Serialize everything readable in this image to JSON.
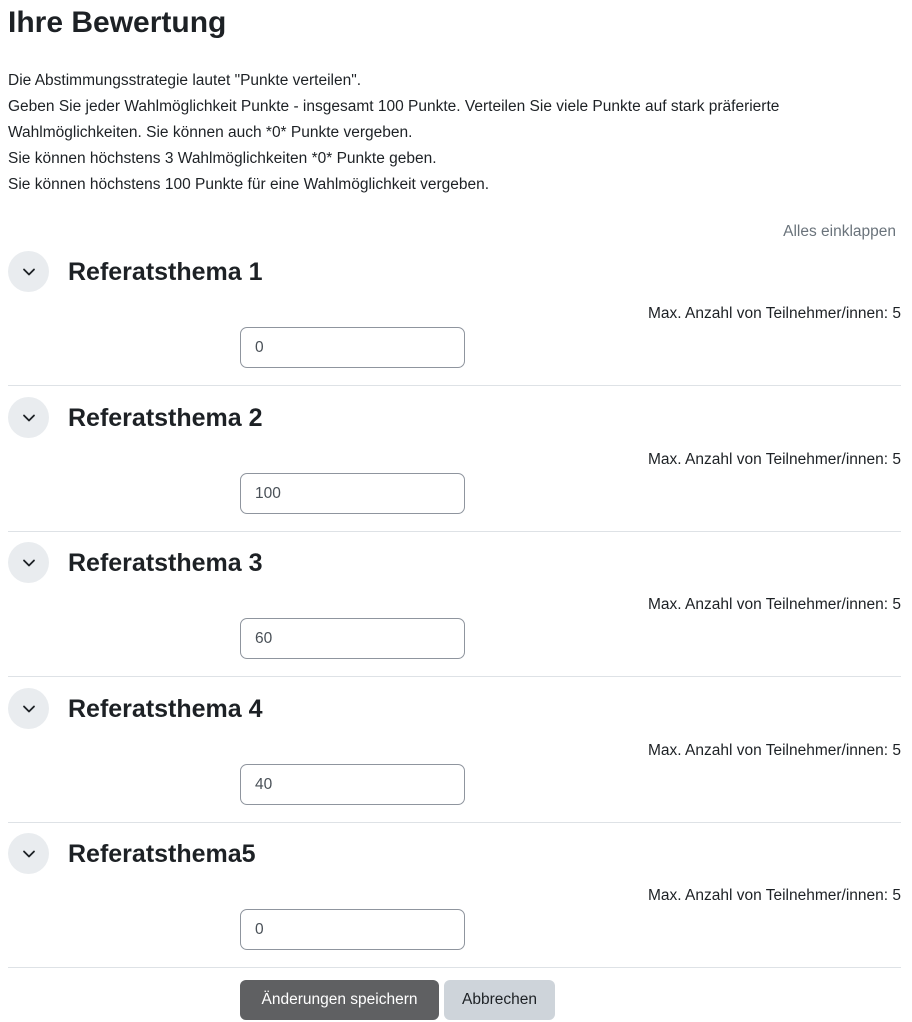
{
  "page": {
    "title": "Ihre Bewertung"
  },
  "intro": {
    "lines": [
      "Die Abstimmungsstrategie lautet \"Punkte verteilen\".",
      "Geben Sie jeder Wahlmöglichkeit Punkte - insgesamt 100 Punkte. Verteilen Sie viele Punkte auf stark präferierte",
      "Wahlmöglichkeiten. Sie können auch *0* Punkte vergeben.",
      "Sie können höchstens 3 Wahlmöglichkeiten *0* Punkte geben.",
      "Sie können höchstens 100 Punkte für eine Wahlmöglichkeit vergeben."
    ]
  },
  "collapse_all_label": "Alles einklappen",
  "sections": [
    {
      "title": "Referatsthema 1",
      "max_label": "Max. Anzahl von Teilnehmer/innen:",
      "max_value": "5",
      "points": "0",
      "toggle_icon": "chevron-down-icon"
    },
    {
      "title": "Referatsthema 2",
      "max_label": "Max. Anzahl von Teilnehmer/innen:",
      "max_value": "5",
      "points": "100",
      "toggle_icon": "chevron-down-icon"
    },
    {
      "title": "Referatsthema 3",
      "max_label": "Max. Anzahl von Teilnehmer/innen:",
      "max_value": "5",
      "points": "60",
      "toggle_icon": "chevron-down-icon"
    },
    {
      "title": "Referatsthema 4",
      "max_label": "Max. Anzahl von Teilnehmer/innen:",
      "max_value": "5",
      "points": "40",
      "toggle_icon": "chevron-down-icon"
    },
    {
      "title": "Referatsthema5",
      "max_label": "Max. Anzahl von Teilnehmer/innen:",
      "max_value": "5",
      "points": "0",
      "toggle_icon": "chevron-down-icon"
    }
  ],
  "actions": {
    "save_label": "Änderungen speichern",
    "cancel_label": "Abbrechen"
  },
  "colors": {
    "primary_button": "#5f6062",
    "secondary_button": "#ced4da",
    "toggle_background": "#e9ecef",
    "muted_link": "#6a737b"
  }
}
